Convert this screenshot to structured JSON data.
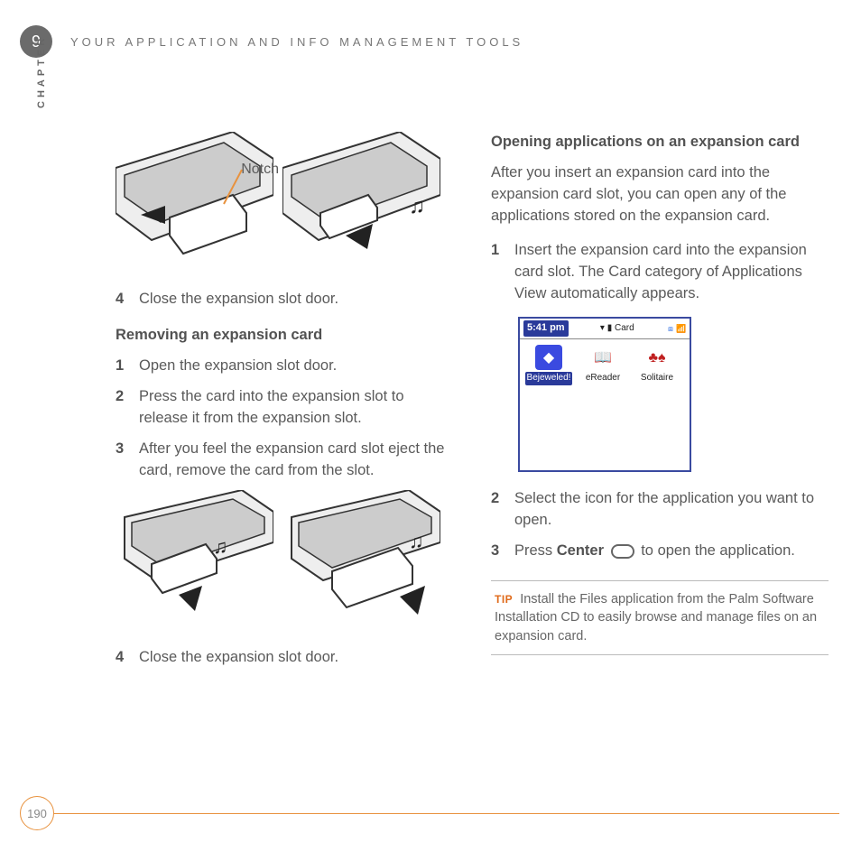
{
  "header": {
    "chapter_number": "9",
    "title": "YOUR APPLICATION AND INFO MANAGEMENT TOOLS",
    "side_label": "CHAPTER"
  },
  "left": {
    "notch_label": "Notch",
    "step4a": "Close the expansion slot door.",
    "heading_remove": "Removing an expansion card",
    "step1": "Open the expansion slot door.",
    "step2": "Press the card into the expansion slot to release it from the expansion slot.",
    "step3": "After you feel the expansion card slot eject the card, remove the card from the slot.",
    "step4b": "Close the expansion slot door."
  },
  "right": {
    "heading_open": "Opening applications on an expansion card",
    "intro": "After you insert an expansion card into the expansion card slot, you can open any of the applications stored on the expansion card.",
    "step1": "Insert the expansion card into the expansion card slot. The Card category of Applications View automatically appears.",
    "step2": "Select the icon for the application you want to open.",
    "step3_a": "Press ",
    "step3_b": "Center",
    "step3_c": " to open the application.",
    "tip_label": "TIP",
    "tip_text": "Install the Files application from the Palm Software Installation CD to easily browse and manage files on an expansion card."
  },
  "screenshot": {
    "time": "5:41 pm",
    "category": "▾ ▮ Card",
    "apps": [
      {
        "name": "Bejeweled!",
        "glyph": "◆",
        "bg": "#3a4ae0",
        "fg": "#fff",
        "selected": true
      },
      {
        "name": "eReader",
        "glyph": "📖",
        "bg": "transparent",
        "fg": "#8a6a2a",
        "selected": false
      },
      {
        "name": "Solitaire",
        "glyph": "♣♠",
        "bg": "transparent",
        "fg": "#c02020",
        "selected": false
      }
    ]
  },
  "page_number": "190"
}
